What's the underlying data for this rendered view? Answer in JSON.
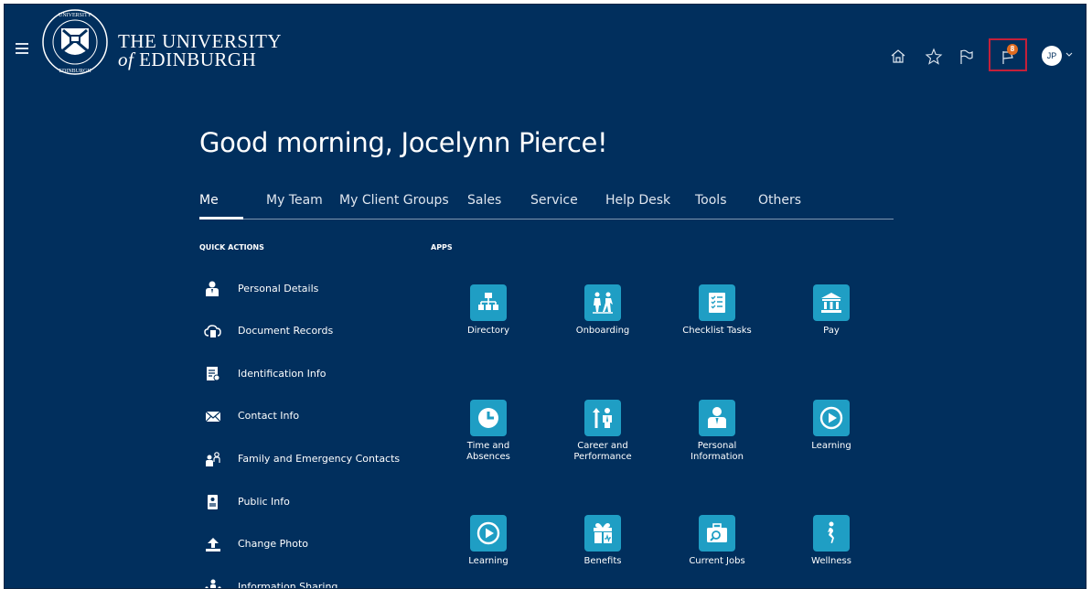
{
  "brand": {
    "line1": "THE UNIVERSITY",
    "line2_prefix": "of",
    "line2_rest": "EDINBURGH"
  },
  "header": {
    "notification_count": "8",
    "avatar_initials": "JP"
  },
  "greeting": "Good morning, Jocelynn Pierce!",
  "tabs": [
    "Me",
    "My Team",
    "My Client Groups",
    "Sales",
    "Service",
    "Help Desk",
    "Tools",
    "Others"
  ],
  "sections": {
    "quick_actions": "QUICK ACTIONS",
    "apps": "APPS"
  },
  "quick_actions": [
    {
      "label": "Personal Details",
      "icon": "person-icon"
    },
    {
      "label": "Document Records",
      "icon": "cloud-document-icon"
    },
    {
      "label": "Identification Info",
      "icon": "id-card-icon"
    },
    {
      "label": "Contact Info",
      "icon": "envelope-icon"
    },
    {
      "label": "Family and Emergency Contacts",
      "icon": "family-icon"
    },
    {
      "label": "Public Info",
      "icon": "badge-icon"
    },
    {
      "label": "Change Photo",
      "icon": "upload-icon"
    },
    {
      "label": "Information Sharing",
      "icon": "sharing-icon"
    }
  ],
  "apps": [
    {
      "label": "Directory",
      "icon": "org-chart-icon"
    },
    {
      "label": "Onboarding",
      "icon": "onboarding-icon"
    },
    {
      "label": "Checklist Tasks",
      "icon": "checklist-icon"
    },
    {
      "label": "Pay",
      "icon": "bank-icon"
    },
    {
      "label1": "Time and",
      "label2": "Absences",
      "icon": "clock-icon"
    },
    {
      "label1": "Career and",
      "label2": "Performance",
      "icon": "career-icon"
    },
    {
      "label1": "Personal",
      "label2": "Information",
      "icon": "person-icon"
    },
    {
      "label": "Learning",
      "icon": "play-circle-icon"
    },
    {
      "label": "Learning",
      "icon": "play-circle-icon"
    },
    {
      "label": "Benefits",
      "icon": "gift-icon"
    },
    {
      "label": "Current Jobs",
      "icon": "job-search-icon"
    },
    {
      "label": "Wellness",
      "icon": "wellness-icon"
    }
  ],
  "colors": {
    "background": "#012f5d",
    "tile": "#1f9ec4",
    "highlight": "#c4203a",
    "badge": "#e06b1f"
  }
}
